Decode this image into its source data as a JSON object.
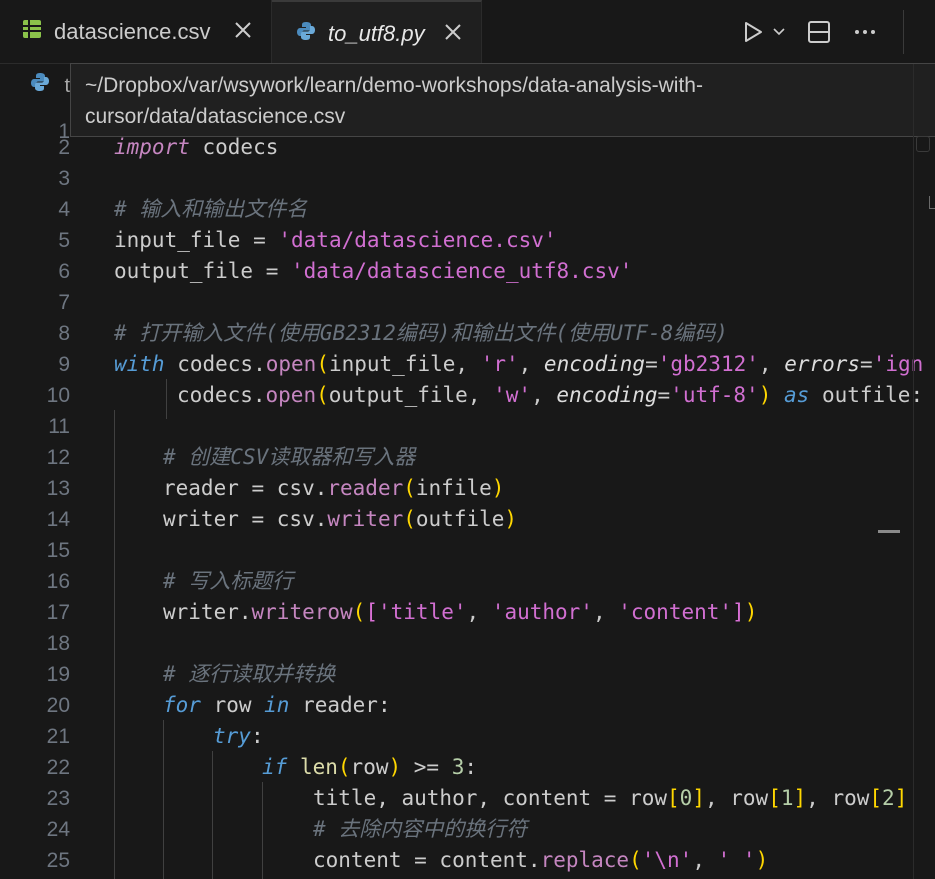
{
  "tabs": [
    {
      "label": "datascience.csv",
      "icon": "table-icon",
      "active": false
    },
    {
      "label": "to_utf8.py",
      "icon": "python-icon",
      "active": true
    }
  ],
  "breadcrumb_prefix": "t",
  "tooltip": {
    "line1": "~/Dropbox/var/wsywork/learn/demo-workshops/data-analysis-with-",
    "line2": "cursor/data/datascience.csv"
  },
  "line_numbers": [
    "1",
    "2",
    "3",
    "4",
    "5",
    "6",
    "7",
    "8",
    "9",
    "10",
    "11",
    "12",
    "13",
    "14",
    "15",
    "16",
    "17",
    "18",
    "19",
    "20",
    "21",
    "22",
    "23",
    "24",
    "25"
  ],
  "code": {
    "l2": {
      "kw": "import",
      "rest": " codecs"
    },
    "l4": "# 输入和输出文件名",
    "l5": {
      "a": "input_file = ",
      "s": "'data/datascience.csv'"
    },
    "l6": {
      "a": "output_file = ",
      "s": "'data/datascience_utf8.csv'"
    },
    "l8": "# 打开输入文件(使用GB2312编码)和输出文件(使用UTF-8编码)",
    "l9": {
      "kw": "with",
      "a": " codecs.",
      "m": "open",
      "p1": "(",
      "b": "input_file, ",
      "s1": "'r'",
      "c": ", ",
      "k1": "encoding",
      "e": "=",
      "s2": "'gb2312'",
      "c2": ", ",
      "k2": "errors",
      "e2": "=",
      "s3": "'ign"
    },
    "l10": {
      "a": "codecs.",
      "m": "open",
      "p1": "(",
      "b": "output_file, ",
      "s1": "'w'",
      "c": ", ",
      "k1": "encoding",
      "e": "=",
      "s2": "'utf-8'",
      "p2": ")",
      "sp": " ",
      "kw": "as",
      "rest": " outfile:"
    },
    "l12": "# 创建CSV读取器和写入器",
    "l13": {
      "a": "reader = csv.",
      "m": "reader",
      "p1": "(",
      "b": "infile",
      "p2": ")"
    },
    "l14": {
      "a": "writer = csv.",
      "m": "writer",
      "p1": "(",
      "b": "outfile",
      "p2": ")"
    },
    "l16": "# 写入标题行",
    "l17": {
      "a": "writer.",
      "m": "writerow",
      "p1": "(",
      "b1": "[",
      "s1": "'title'",
      "c1": ", ",
      "s2": "'author'",
      "c2": ", ",
      "s3": "'content'",
      "b2": "]",
      "p2": ")"
    },
    "l19": "# 逐行读取并转换",
    "l20": {
      "kw1": "for",
      "a": " row ",
      "kw2": "in",
      "b": " reader:"
    },
    "l21": {
      "kw": "try",
      "a": ":"
    },
    "l22": {
      "kw": "if",
      "sp": " ",
      "fn": "len",
      "p1": "(",
      "a": "row",
      "p2": ")",
      "b": " >= ",
      "n": "3",
      "c": ":"
    },
    "l23": {
      "a": "title, author, content = row",
      "b1": "[",
      "n1": "0",
      "b2": "]",
      "c1": ", row",
      "b3": "[",
      "n2": "1",
      "b4": "]",
      "c2": ", row",
      "b5": "[",
      "n3": "2",
      "b6": "]"
    },
    "l24": "# 去除内容中的换行符",
    "l25": {
      "a": "content = content.",
      "m": "replace",
      "p1": "(",
      "s1": "'\\n'",
      "c": ", ",
      "s2": "' '",
      "p2": ")"
    }
  }
}
